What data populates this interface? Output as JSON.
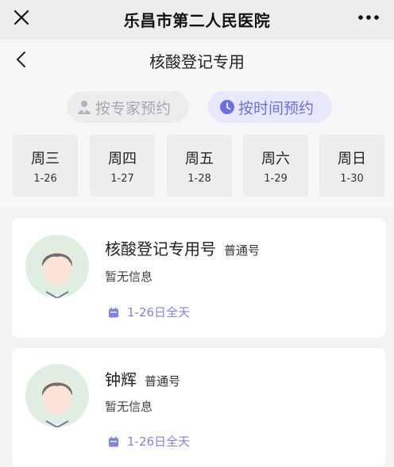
{
  "app": {
    "title": "乐昌市第二人民医院"
  },
  "page": {
    "title": "核酸登记专用"
  },
  "modes": {
    "expert_label": "按专家预约",
    "time_label": "按时间预约",
    "active": "time"
  },
  "days": [
    {
      "weekday": "周三",
      "date": "1-26"
    },
    {
      "weekday": "周四",
      "date": "1-27"
    },
    {
      "weekday": "周五",
      "date": "1-28"
    },
    {
      "weekday": "周六",
      "date": "1-29"
    },
    {
      "weekday": "周日",
      "date": "1-30"
    }
  ],
  "doctors": [
    {
      "name": "核酸登记专用号",
      "type": "普通号",
      "info": "暂无信息",
      "schedule": "1-26日全天"
    },
    {
      "name": "钟辉",
      "type": "普通号",
      "info": "暂无信息",
      "schedule": "1-26日全天"
    }
  ],
  "colors": {
    "accent": "#6b6fe6",
    "accent_bg": "#e8e8fb",
    "avatar_bg": "#dfeee0"
  },
  "icons": {
    "close": "close-icon",
    "more": "more-icon",
    "back": "back-icon",
    "expert": "doctor-icon",
    "time": "clock-icon",
    "schedule": "calendar-icon",
    "avatar": "doctor-avatar-icon"
  }
}
